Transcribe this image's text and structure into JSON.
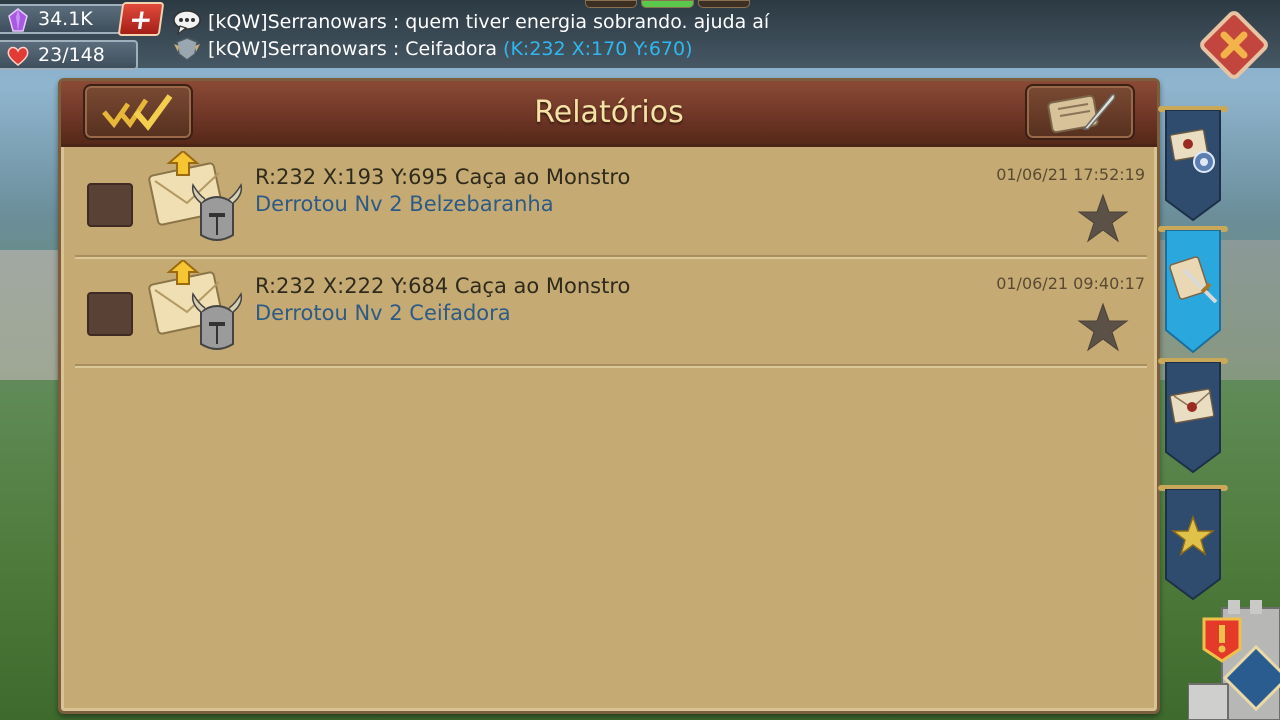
{
  "resources": {
    "gems": "34.1K",
    "energy": "23/148"
  },
  "chat": {
    "line1": "[kQW]Serranowars : quem tiver energia sobrando. ajuda aí",
    "line2_text": "[kQW]Serranowars : Ceifadora",
    "line2_coords": "(K:232 X:170 Y:670)"
  },
  "panel": {
    "title": "Relatórios"
  },
  "reports": [
    {
      "title": "R:232 X:193 Y:695 Caça ao Monstro",
      "subtitle": "Derrotou Nv 2 Belzebaranha",
      "date": "01/06/21 17:52:19"
    },
    {
      "title": "R:232 X:222 Y:684 Caça ao Monstro",
      "subtitle": "Derrotou Nv 2 Ceifadora",
      "date": "01/06/21 09:40:17"
    }
  ],
  "icons": {
    "gem": "gem-icon",
    "heart": "heart-icon",
    "plus": "plus-icon",
    "chat": "chat-bubble-icon",
    "guild": "guild-crest-icon",
    "close": "close-icon",
    "mark_all_read": "check-all-icon",
    "compose": "scroll-quill-icon",
    "report_mail": "mail-helmet-icon",
    "favorite": "star-icon",
    "tab_settings": "mail-settings-icon",
    "tab_reports": "scroll-sword-icon",
    "tab_mail": "mail-seal-icon",
    "tab_favorites": "star-tab-icon",
    "alert": "alert-icon"
  },
  "colors": {
    "header_bg": "#6d3526",
    "panel_bg": "#c5ab73",
    "title_text": "#f4e3a6",
    "subtitle_text": "#2e5a86",
    "coords_text": "#2fb8ef",
    "close_btn": "#c2463e",
    "active_tab": "#2aa7dd",
    "tab_bg": "#2f4c6e"
  }
}
